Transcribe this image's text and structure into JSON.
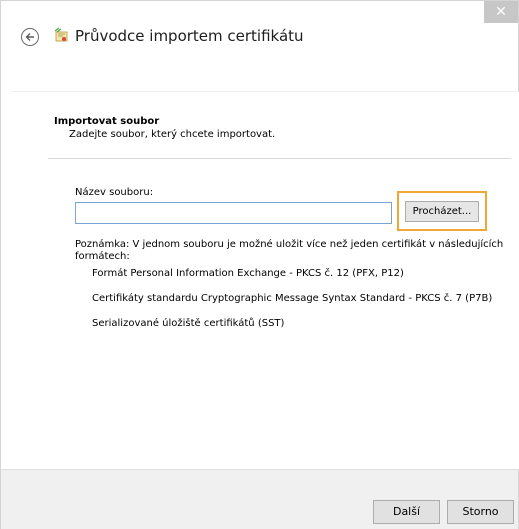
{
  "window": {
    "close_glyph": "✕"
  },
  "header": {
    "title": "Průvodce importem certifikátu",
    "back_icon": "back-arrow-icon",
    "wizard_icon": "certificate-wizard-icon"
  },
  "section": {
    "title": "Importovat soubor",
    "description": "Zadejte soubor, který chcete importovat."
  },
  "file_field": {
    "label": "Název souboru:",
    "value": "",
    "browse_label": "Procházet..."
  },
  "note": {
    "text": "Poznámka: V jednom souboru je možné uložit více než jeden certifikát v následujících formátech:",
    "formats": [
      "Formát Personal Information Exchange - PKCS č. 12 (PFX, P12)",
      "Certifikáty standardu Cryptographic Message Syntax Standard - PKCS č. 7 (P7B)",
      "Serializované úložiště certifikátů (SST)"
    ]
  },
  "footer": {
    "next_label": "Další",
    "cancel_label": "Storno"
  },
  "colors": {
    "focus_border": "#f0a738",
    "input_border": "#7aa3d8",
    "close_button": "#c7c7c7"
  }
}
